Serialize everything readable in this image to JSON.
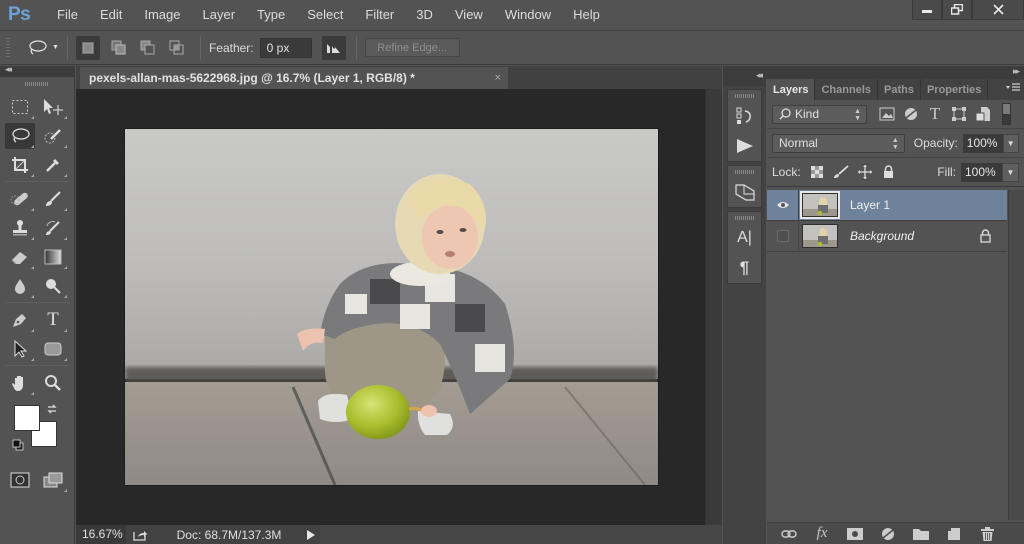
{
  "app": {
    "logo": "Ps",
    "menu": [
      "File",
      "Edit",
      "Image",
      "Layer",
      "Type",
      "Select",
      "Filter",
      "3D",
      "View",
      "Window",
      "Help"
    ],
    "window_controls": {
      "minimize": "minimize-icon",
      "restore": "restore-icon",
      "close": "close-icon"
    }
  },
  "options_bar": {
    "tool_icon": "lasso-icon",
    "selection_modes": [
      {
        "name": "new-selection",
        "active": true
      },
      {
        "name": "add-to-selection",
        "active": false
      },
      {
        "name": "subtract-from-selection",
        "active": false
      },
      {
        "name": "intersect-with-selection",
        "active": false
      }
    ],
    "feather_label": "Feather:",
    "feather_value": "0 px",
    "anti_alias_icon": "anti-alias-icon",
    "refine_edge_label": "Refine Edge..."
  },
  "tools": {
    "collapse_glyph": "◂◂",
    "rows": [
      [
        "rectangular-marquee",
        "move"
      ],
      [
        "lasso",
        "quick-selection"
      ],
      [
        "crop",
        "eyedropper"
      ],
      [
        "spot-healing-brush",
        "brush"
      ],
      [
        "clone-stamp",
        "history-brush"
      ],
      [
        "eraser",
        "gradient"
      ],
      [
        "blur",
        "dodge"
      ],
      [
        "pen",
        "type"
      ],
      [
        "path-selection",
        "rectangle"
      ],
      [
        "hand",
        "zoom"
      ]
    ],
    "active_tool": "lasso",
    "foreground_color": "#ffffff",
    "background_color": "#ffffff"
  },
  "document": {
    "tab_title": "pexels-allan-mas-5622968.jpg @ 16.7% (Layer 1, RGB/8) *",
    "tab_close": "×",
    "image_subject": "Blonde toddler in checkered sweater crouching with a green balloon",
    "zoom": "16.67%",
    "doc_info": "Doc: 68.7M/137.3M"
  },
  "dock": {
    "collapse_glyph": "◂◂",
    "buttons": [
      "history-icon",
      "actions-play-icon",
      "3d-transform-icon",
      "character-icon",
      "paragraph-icon"
    ]
  },
  "layers_panel": {
    "tabs": [
      {
        "label": "Layers",
        "active": true
      },
      {
        "label": "Channels",
        "active": false
      },
      {
        "label": "Paths",
        "active": false
      },
      {
        "label": "Properties",
        "active": false
      }
    ],
    "filter_kind": "Kind",
    "blend_mode": "Normal",
    "opacity_label": "Opacity:",
    "opacity_value": "100%",
    "lock_label": "Lock:",
    "fill_label": "Fill:",
    "fill_value": "100%",
    "layers": [
      {
        "name": "Layer 1",
        "visible": true,
        "selected": true,
        "locked": false,
        "italic": false
      },
      {
        "name": "Background",
        "visible": false,
        "selected": false,
        "locked": true,
        "italic": true
      }
    ],
    "footer_icons": [
      "link-layers-icon",
      "fx-icon",
      "add-mask-icon",
      "adjustment-layer-icon",
      "new-group-icon",
      "new-layer-icon",
      "delete-layer-icon"
    ]
  }
}
